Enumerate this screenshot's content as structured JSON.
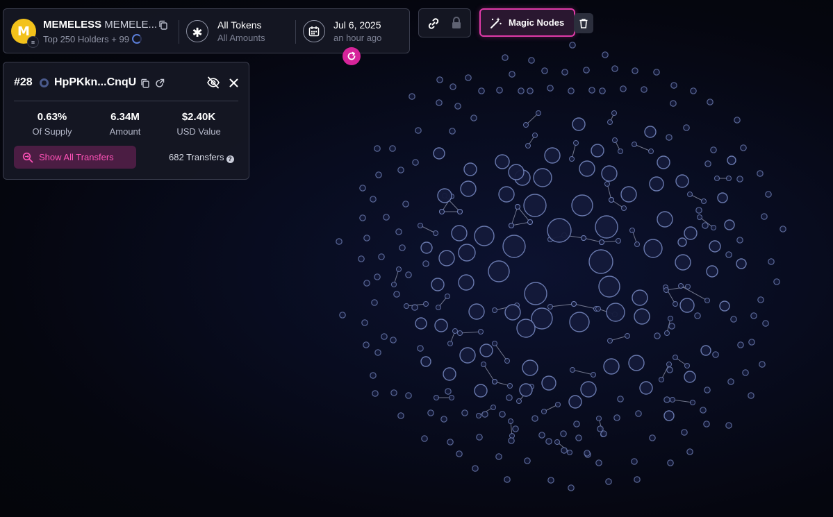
{
  "token": {
    "name": "MEMELESS",
    "symbol": "MEMELE...",
    "logo_letter": "M",
    "chain_icon": "solana-icon",
    "holders_label": "Top 250 Holders + 99"
  },
  "filter": {
    "title": "All Tokens",
    "subtitle": "All Amounts"
  },
  "date": {
    "title": "Jul 6, 2025",
    "subtitle": "an hour ago"
  },
  "toolbar": {
    "magic_nodes_label": "Magic Nodes"
  },
  "holder": {
    "rank": "#28",
    "address": "HpPKkn...CnqU",
    "stats": [
      {
        "value": "0.63%",
        "label": "Of Supply"
      },
      {
        "value": "6.34M",
        "label": "Amount"
      },
      {
        "value": "$2.40K",
        "label": "USD Value"
      }
    ],
    "show_transfers_label": "Show All Transfers",
    "transfers_count": "682 Transfers"
  },
  "colors": {
    "accent": "#e03aa8",
    "bubble_stroke": "#6f7fb5",
    "bubble_fill": "#141a3a",
    "token_logo": "#f3c21b"
  }
}
